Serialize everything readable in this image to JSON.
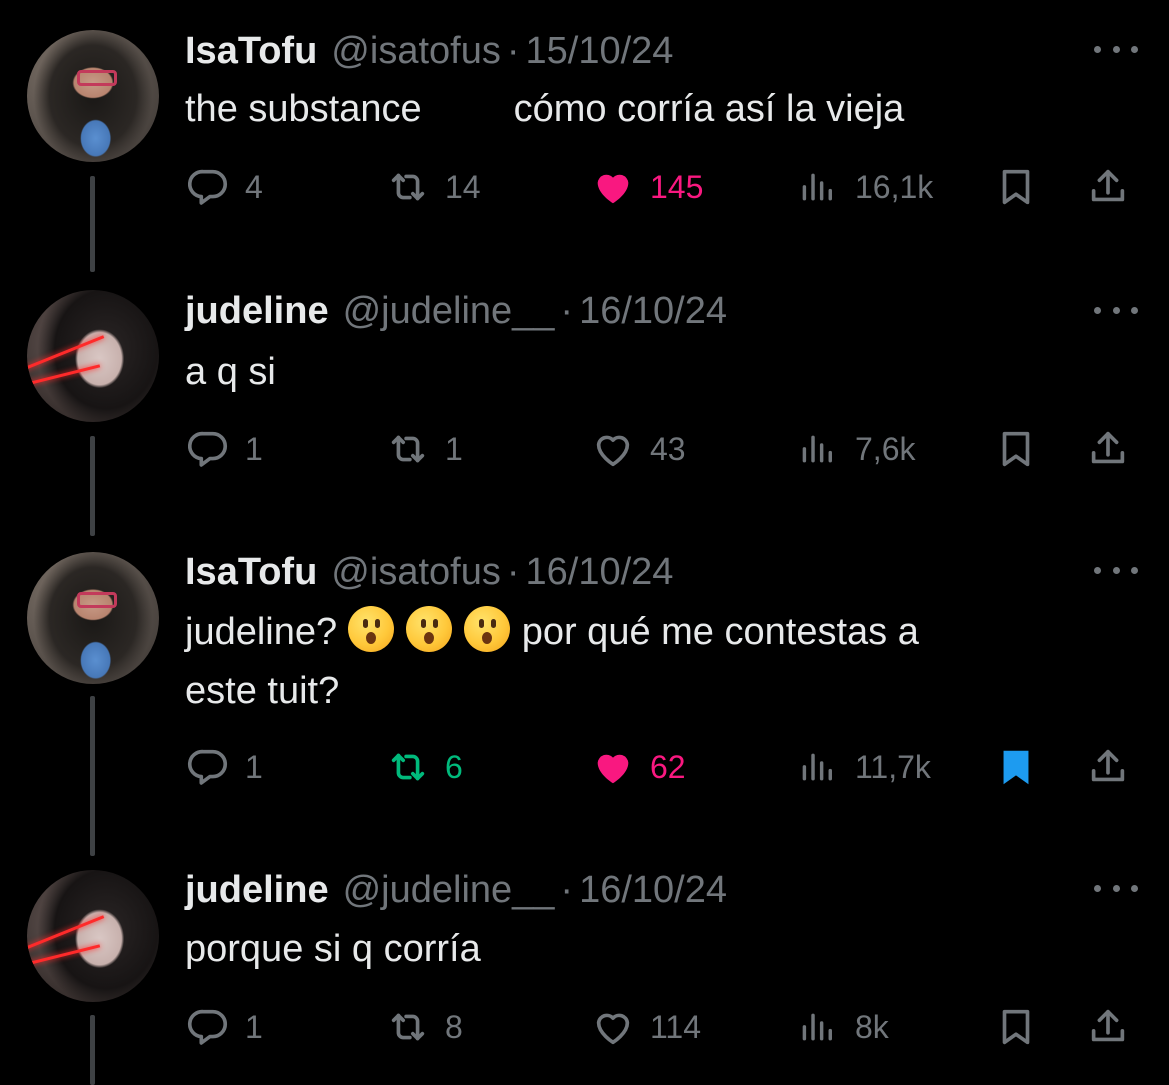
{
  "colors": {
    "background": "#000000",
    "text_primary": "#e7e9ea",
    "text_secondary": "#71767b",
    "like_active": "#f91880",
    "retweet_active": "#00ba7c",
    "bookmark_active": "#1d9bf0"
  },
  "tweets": [
    {
      "name": "IsaTofu",
      "handle": "@isatofus",
      "sep": "·",
      "date": "15/10/24",
      "text_part1": "the substance",
      "text_part2": "cómo corría así la vieja",
      "reply_count": "4",
      "retweet_count": "14",
      "like_count": "145",
      "views": "16,1k",
      "liked": true,
      "retweeted": false,
      "bookmarked": false
    },
    {
      "name": "judeline",
      "handle": "@judeline__",
      "sep": "·",
      "date": "16/10/24",
      "text": "a q si",
      "reply_count": "1",
      "retweet_count": "1",
      "like_count": "43",
      "views": "7,6k",
      "liked": false,
      "retweeted": false,
      "bookmarked": false
    },
    {
      "name": "IsaTofu",
      "handle": "@isatofus",
      "sep": "·",
      "date": "16/10/24",
      "text_line1_a": "judeline?",
      "text_line1_b": "por qué me contestas a",
      "text_line2": "este tuit?",
      "emoji": "hushed-face-emoji",
      "reply_count": "1",
      "retweet_count": "6",
      "like_count": "62",
      "views": "11,7k",
      "liked": true,
      "retweeted": true,
      "bookmarked": true
    },
    {
      "name": "judeline",
      "handle": "@judeline__",
      "sep": "·",
      "date": "16/10/24",
      "text": "porque si q corría",
      "reply_count": "1",
      "retweet_count": "8",
      "like_count": "114",
      "views": "8k",
      "liked": false,
      "retweeted": false,
      "bookmarked": false
    }
  ],
  "icons": {
    "reply": "reply-icon",
    "retweet": "retweet-icon",
    "like": "heart-icon",
    "views": "views-chart-icon",
    "bookmark": "bookmark-icon",
    "share": "share-icon",
    "more": "more-dots-icon"
  }
}
